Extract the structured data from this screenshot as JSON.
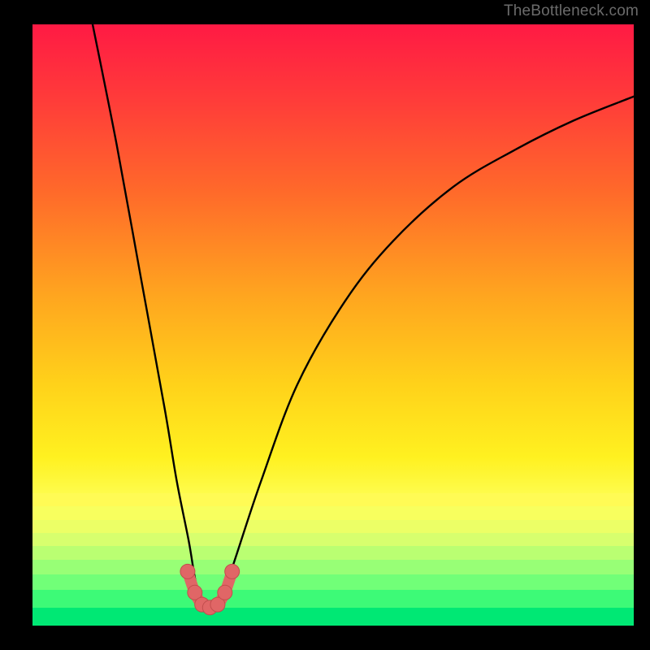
{
  "watermark": "TheBottleneck.com",
  "colors": {
    "background": "#000000",
    "curve_stroke": "#000000",
    "marker_fill": "#e06666",
    "marker_stroke": "#c24d4d",
    "gradient_top": "#ff1a44",
    "gradient_bottom": "#00e874"
  },
  "chart_data": {
    "type": "line",
    "title": "",
    "xlabel": "",
    "ylabel": "",
    "xlim": [
      0,
      100
    ],
    "ylim": [
      0,
      100
    ],
    "grid": false,
    "legend_position": "none",
    "series": [
      {
        "name": "bottleneck-curve",
        "x": [
          10,
          14,
          18,
          22,
          24,
          26,
          27,
          28,
          29,
          30,
          31,
          32,
          34,
          38,
          44,
          52,
          60,
          70,
          80,
          90,
          100
        ],
        "values": [
          100,
          80,
          58,
          36,
          24,
          14,
          8,
          4,
          3,
          3,
          4,
          6,
          12,
          24,
          40,
          54,
          64,
          73,
          79,
          84,
          88
        ]
      }
    ],
    "markers": {
      "name": "valley-markers",
      "x": [
        25.8,
        27.0,
        28.2,
        29.5,
        30.8,
        32.0,
        33.2
      ],
      "values": [
        9.0,
        5.5,
        3.5,
        3.0,
        3.5,
        5.5,
        9.0
      ]
    }
  }
}
